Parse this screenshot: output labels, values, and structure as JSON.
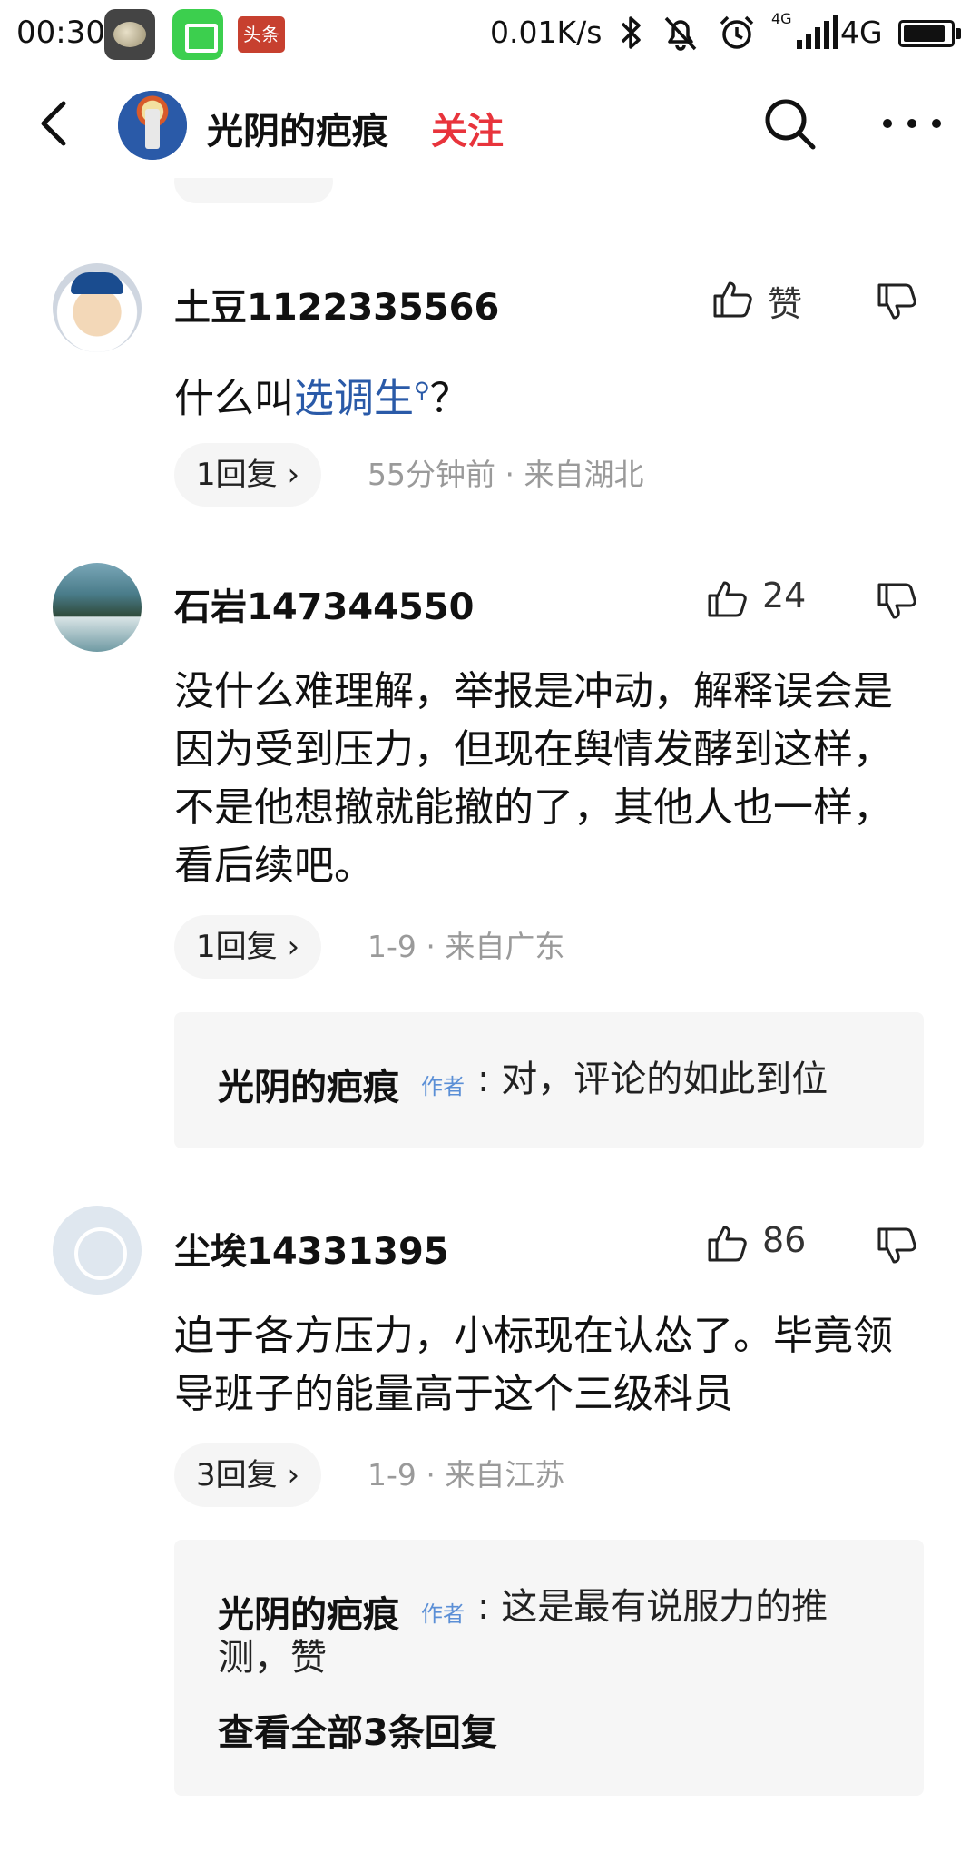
{
  "status_bar": {
    "time": "00:30",
    "app3_label": "头条",
    "net_speed": "0.01K/s",
    "network_small": "4G",
    "network": "4G",
    "battery_percent": 90
  },
  "header": {
    "title": "光阴的疤痕",
    "follow_label": "关注"
  },
  "comments": [
    {
      "username": "土豆1122335566",
      "like_label": "赞",
      "text_before": "什么叫",
      "topic_link": "选调生",
      "text_after": "？",
      "reply_label": "1回复 ›",
      "meta": "55分钟前 · 来自湖北"
    },
    {
      "username": "石岩147344550",
      "like_label": "24",
      "text": "没什么难理解，举报是冲动，解释误会是因为受到压力，但现在舆情发酵到这样，不是他想撤就能撤的了，其他人也一样，看后续吧。",
      "reply_label": "1回复 ›",
      "meta": "1-9 · 来自广东",
      "author_reply": {
        "name": "光阴的疤痕",
        "tag": "作者",
        "text": ": 对，评论的如此到位"
      }
    },
    {
      "username": "尘埃14331395",
      "like_label": "86",
      "text": "迫于各方压力，小标现在认怂了。毕竟领导班子的能量高于这个三级科员",
      "reply_label": "3回复 ›",
      "meta": "1-9 · 来自江苏",
      "author_reply": {
        "name": "光阴的疤痕",
        "tag": "作者",
        "text_line1": ": 这是最有说服力的推",
        "text_line2": "测，赞",
        "view_all": "查看全部3条回复"
      }
    }
  ]
}
